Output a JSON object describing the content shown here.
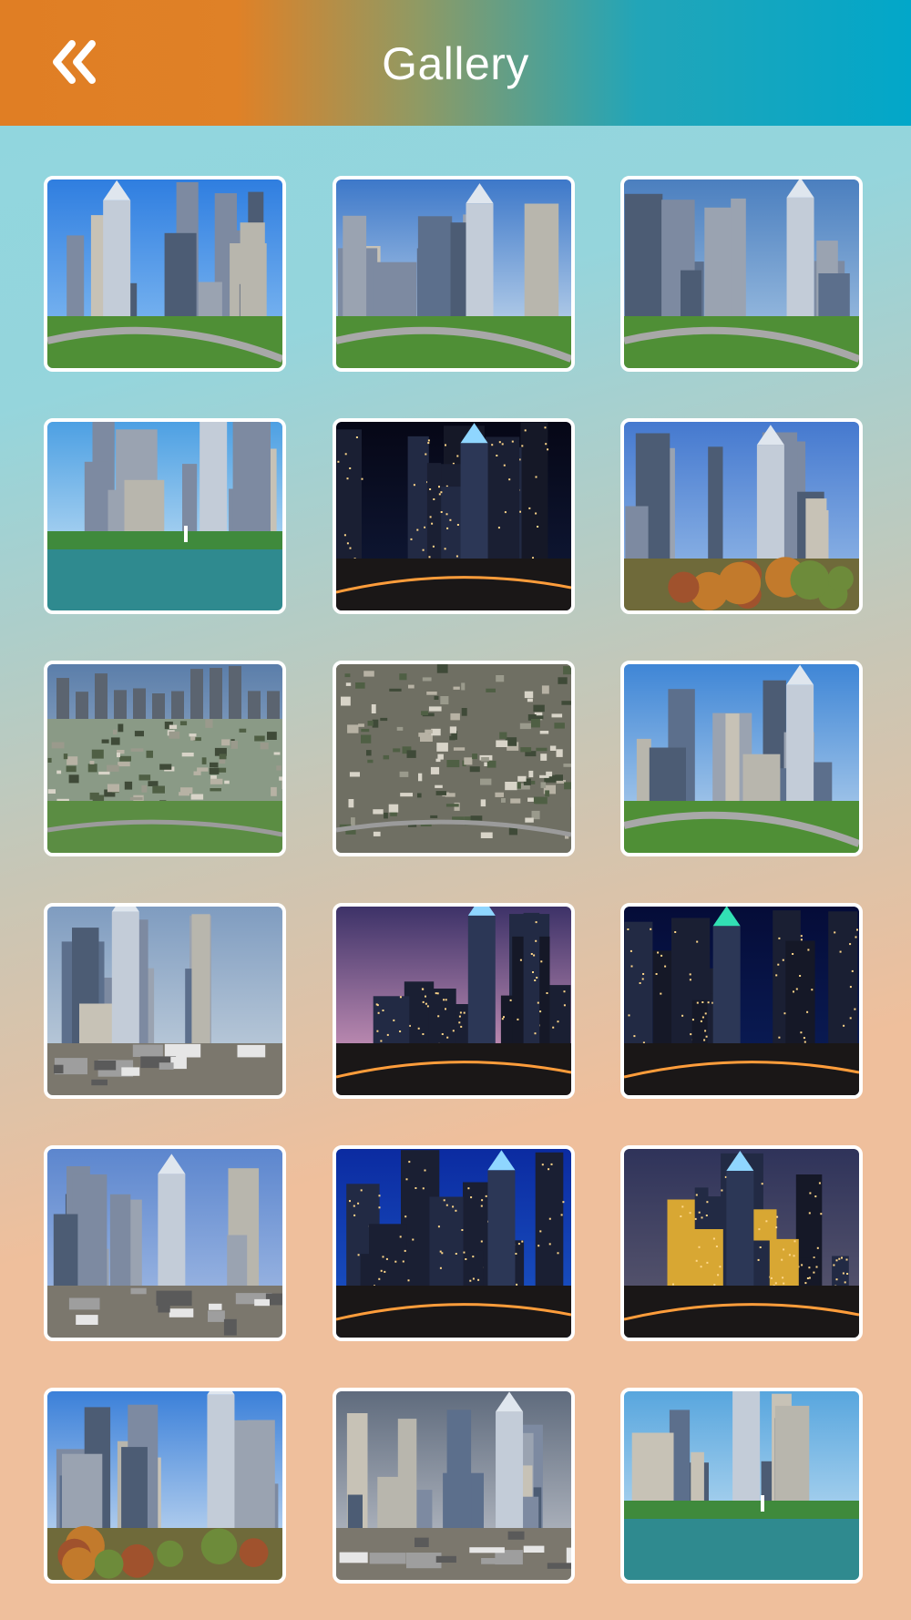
{
  "header": {
    "title": "Gallery",
    "back_icon": "double-chevron-left-icon",
    "colors": {
      "left": "#e07e24",
      "right": "#02a7c9"
    }
  },
  "gallery": {
    "columns": 3,
    "items": [
      {
        "name": "skyline-daytime-towers",
        "scene": "day",
        "sky": [
          "#2f7ee0",
          "#8cc2f4"
        ]
      },
      {
        "name": "skyline-cloudy-glass-tower",
        "scene": "day",
        "sky": [
          "#3d78c9",
          "#d4e4f1"
        ]
      },
      {
        "name": "skyline-highway-trees",
        "scene": "day",
        "sky": [
          "#4b7fbf",
          "#a9c8e6"
        ]
      },
      {
        "name": "lake-fountain-city",
        "scene": "lake",
        "sky": [
          "#4da0e3",
          "#d9ecf8"
        ]
      },
      {
        "name": "skyline-night-lights",
        "scene": "night",
        "sky": [
          "#060716",
          "#101a3a"
        ]
      },
      {
        "name": "skyline-autumn-trees",
        "scene": "autumn",
        "sky": [
          "#4579cf",
          "#9cc0ea"
        ]
      },
      {
        "name": "aerial-city-greens",
        "scene": "aerial",
        "sky": [
          "#5b7eaa",
          "#b8c7d6"
        ]
      },
      {
        "name": "aerial-suburbs",
        "scene": "aerial-dense",
        "sky": [
          "#58605a",
          "#8d8f80"
        ]
      },
      {
        "name": "skyline-park-field",
        "scene": "field",
        "sky": [
          "#3f86d6",
          "#bcd6ee"
        ]
      },
      {
        "name": "skyline-hazy-towers",
        "scene": "hazy",
        "sky": [
          "#7f9cc0",
          "#c9d5df"
        ]
      },
      {
        "name": "skyline-dusk-bridge",
        "scene": "dusk",
        "sky": [
          "#3d3268",
          "#e6a7c9"
        ]
      },
      {
        "name": "skyline-night-green-crown",
        "scene": "night2",
        "sky": [
          "#050c38",
          "#0b1f5b"
        ]
      },
      {
        "name": "skyline-clear-towers",
        "scene": "clear",
        "sky": [
          "#5c86ce",
          "#a9c0e6"
        ]
      },
      {
        "name": "skyline-blue-hour",
        "scene": "bluehour",
        "sky": [
          "#0b2ba1",
          "#1c57c6"
        ]
      },
      {
        "name": "skyline-gold-towers-dusk",
        "scene": "gold",
        "sky": [
          "#2f335a",
          "#5f5c71"
        ]
      },
      {
        "name": "skyline-autumn-foreground",
        "scene": "autumn2",
        "sky": [
          "#3b80d9",
          "#d7e6f4"
        ]
      },
      {
        "name": "skyline-downtown-hotel",
        "scene": "downtown",
        "sky": [
          "#5f6b7d",
          "#c3c7cf"
        ]
      },
      {
        "name": "lake-fountain-city-wide",
        "scene": "lake2",
        "sky": [
          "#58a6de",
          "#d2e8f6"
        ]
      }
    ]
  }
}
